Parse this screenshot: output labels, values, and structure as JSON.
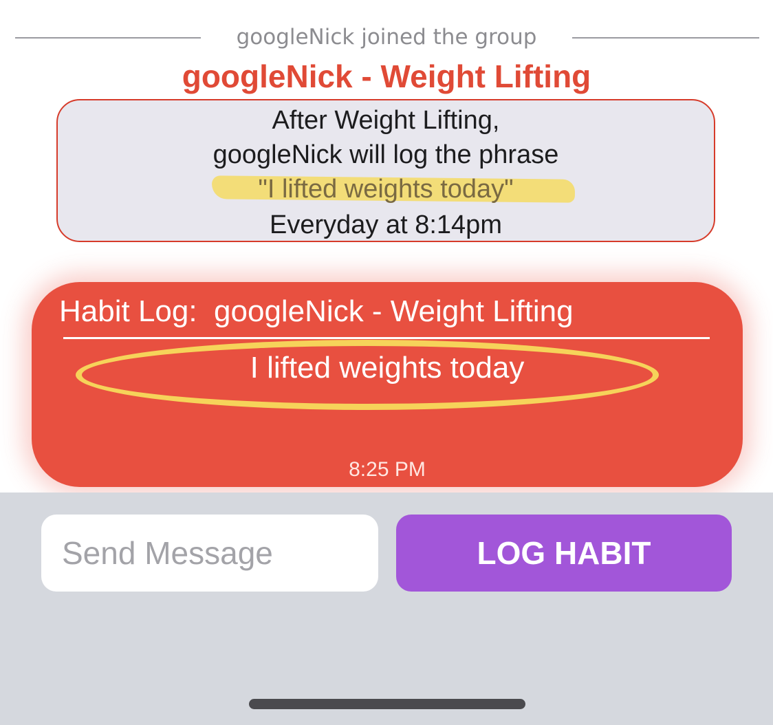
{
  "system_message": {
    "text": "googleNick joined the group"
  },
  "habit": {
    "title": "googleNick - Weight Lifting",
    "info_lines": [
      "After Weight Lifting,",
      "googleNick will log the phrase",
      "\"I lifted weights today\"",
      "Everyday at 8:14pm"
    ]
  },
  "habit_log": {
    "header": "Habit Log:  googleNick - Weight Lifting",
    "message": "I lifted weights today",
    "time": "8:25 PM"
  },
  "composer": {
    "placeholder": "Send Message",
    "value": "",
    "log_button_label": "LOG HABIT"
  },
  "colors": {
    "accent_red": "#e04a36",
    "bubble_red": "#e85040",
    "button_purple": "#a256d9",
    "highlight_yellow": "#f4da63",
    "bar_gray": "#d5d8de"
  }
}
